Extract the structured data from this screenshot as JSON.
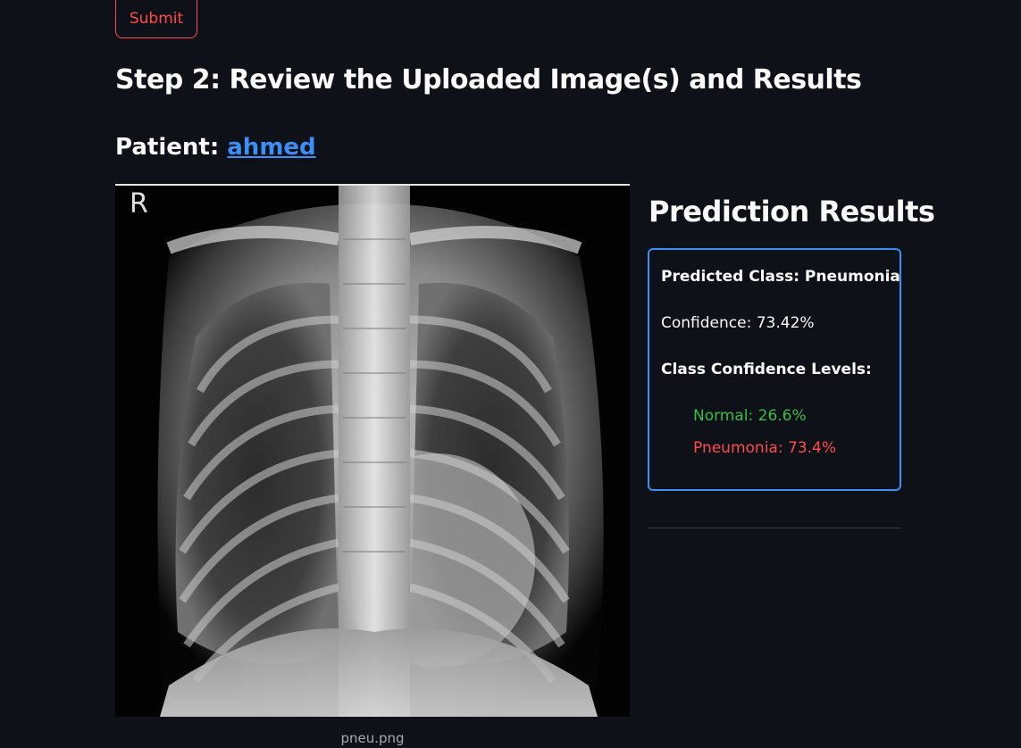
{
  "form": {
    "submit_label": "Submit"
  },
  "step2": {
    "title": "Step 2: Review the Uploaded Image(s) and Results"
  },
  "patient": {
    "prefix": "Patient: ",
    "name": "ahmed"
  },
  "image": {
    "caption": "pneu.png",
    "corner_marker": "R"
  },
  "results": {
    "title": "Prediction Results",
    "predicted_class": "Predicted Class: Pneumonia",
    "confidence": "Confidence: 73.42%",
    "levels_heading": "Class Confidence Levels:",
    "levels": [
      {
        "label": "Normal: 26.6%",
        "color": "#3dbb4a"
      },
      {
        "label": "Pneumonia: 73.4%",
        "color": "#ff4b4b"
      }
    ],
    "border_color": "#3b8ff5"
  },
  "colors": {
    "background": "#0e1117",
    "accent_red": "#ff4b4b",
    "link_blue": "#3b8ff5"
  }
}
